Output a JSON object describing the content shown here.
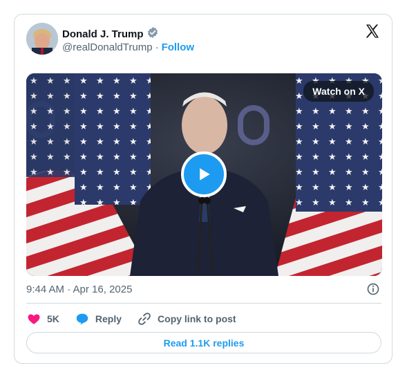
{
  "author": {
    "name": "Donald J. Trump",
    "handle": "@realDonaldTrump",
    "separator": "·",
    "follow_label": "Follow"
  },
  "media": {
    "watch_label": "Watch on X"
  },
  "meta": {
    "timestamp": "9:44 AM · Apr 16, 2025"
  },
  "actions": {
    "likes": "5K",
    "reply_label": "Reply",
    "copy_label": "Copy link to post"
  },
  "footer": {
    "read_replies": "Read 1.1K replies"
  },
  "colors": {
    "accent": "#1d9bf0",
    "like": "#f91880",
    "muted": "#536471",
    "border": "#cfd9de"
  },
  "icons": [
    "x-logo-icon",
    "verified-badge-icon",
    "play-icon",
    "info-icon",
    "heart-icon",
    "reply-icon",
    "link-icon"
  ]
}
